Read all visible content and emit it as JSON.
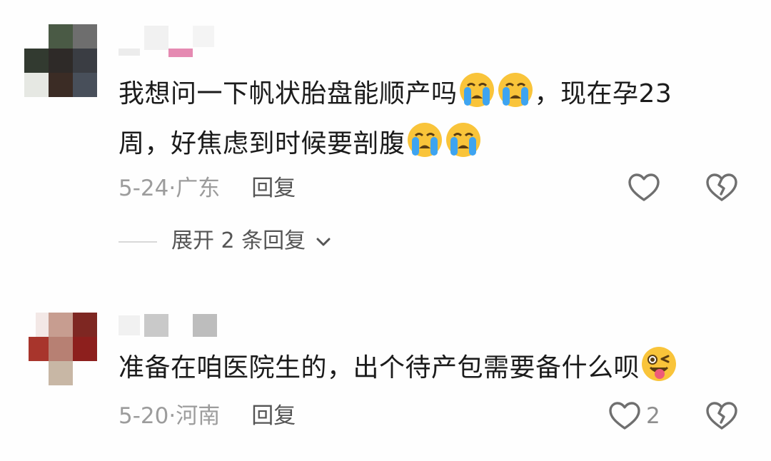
{
  "comments": [
    {
      "text_line1": "我想问一下帆状胎盘能顺产吗",
      "text_line1_end": "，现在孕23",
      "text_line2": "周，好焦虑到时候要剖腹",
      "emojis": [
        "loudly-crying-face",
        "loudly-crying-face",
        "loudly-crying-face",
        "loudly-crying-face"
      ],
      "date": "5-24",
      "sep": "·",
      "location": "广东",
      "reply_label": "回复",
      "expand_label": "展开 2 条回复"
    },
    {
      "text_line1": "准备在咱医院生的，出个待产包需要备什么呗",
      "emojis": [
        "winking-face-with-tongue"
      ],
      "date": "5-20",
      "sep": "·",
      "location": "河南",
      "reply_label": "回复",
      "like_count": "2"
    }
  ],
  "icons": {
    "like": "heart-outline-icon",
    "dislike": "broken-heart-outline-icon",
    "expand": "chevron-down-icon"
  },
  "colors": {
    "text": "#1b1b1b",
    "meta": "#9c9c9c",
    "reply": "#555555",
    "icon": "#6f6f6f"
  }
}
